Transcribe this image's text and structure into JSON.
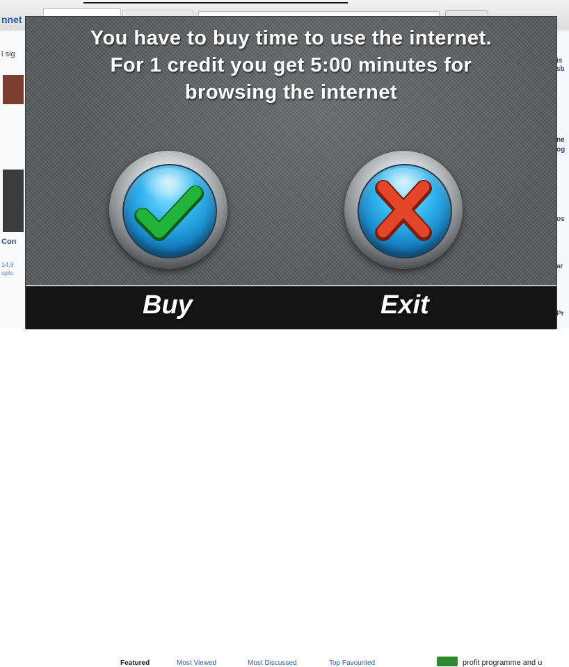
{
  "background_page": {
    "logo_text": "nnet",
    "left_snippets": [
      "l sig",
      "Con",
      "14,9",
      "uplo"
    ],
    "right_snippets": [
      "is",
      "sb",
      "ne",
      "og",
      "os",
      "ar",
      "Pr"
    ],
    "bottom_links": {
      "featured": "Featured",
      "most_viewed": "Most Viewed",
      "most_discussed": "Most Discussed",
      "top_favourited": "Top Favourited"
    },
    "profit_text": "profit programme and u"
  },
  "modal": {
    "message_lines": [
      "You have to buy time to use the internet.",
      "For 1 credit you get 5:00 minutes for",
      "browsing the internet"
    ],
    "buy_label": "Buy",
    "exit_label": "Exit",
    "icons": {
      "buy": "checkmark-icon",
      "exit": "x-cross-icon"
    },
    "colors": {
      "check": "#22b33a",
      "cross": "#e4462a",
      "button_blue": "#1784c6",
      "bar": "#141414"
    }
  }
}
